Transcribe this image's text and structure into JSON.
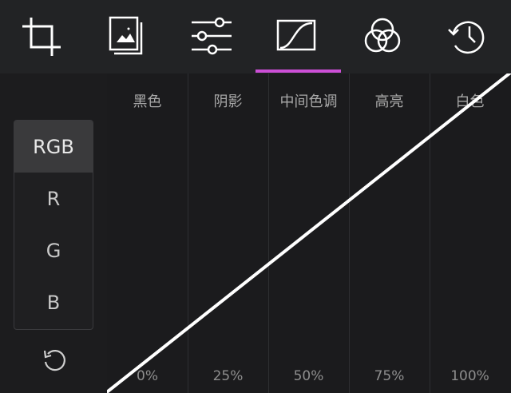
{
  "toolbar": {
    "tools": [
      {
        "icon": "crop-icon"
      },
      {
        "icon": "photo-stack-icon"
      },
      {
        "icon": "sliders-icon"
      },
      {
        "icon": "curve-icon",
        "selected": true
      },
      {
        "icon": "color-circles-icon"
      },
      {
        "icon": "history-icon"
      }
    ],
    "accent_color": "#cc4fd6"
  },
  "channels": {
    "items": [
      "RGB",
      "R",
      "G",
      "B"
    ],
    "selected": "RGB"
  },
  "curve": {
    "zones": [
      "黑色",
      "阴影",
      "中间色调",
      "高亮",
      "白色"
    ],
    "percent_labels": [
      "0%",
      "25%",
      "50%",
      "75%",
      "100%"
    ],
    "points": [
      [
        0,
        0
      ],
      [
        100,
        100
      ]
    ]
  },
  "reset_icon": "undo-icon"
}
